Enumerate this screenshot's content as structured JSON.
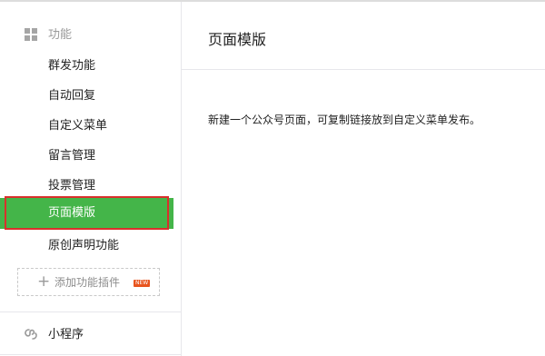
{
  "sidebar": {
    "section_title": "功能",
    "section_icon": "grid-icon",
    "items": [
      {
        "label": "群发功能"
      },
      {
        "label": "自动回复"
      },
      {
        "label": "自定义菜单"
      },
      {
        "label": "留言管理"
      },
      {
        "label": "投票管理"
      },
      {
        "label": "页面模版",
        "active": true
      },
      {
        "label": "原创声明功能"
      }
    ],
    "add_plugin": {
      "icon": "plus-icon",
      "label": "添加功能插件",
      "badge": "NEW"
    },
    "mini_program": {
      "icon": "mini-program-icon",
      "label": "小程序"
    }
  },
  "main": {
    "title": "页面模版",
    "description": "新建一个公众号页面，可复制链接放到自定义菜单发布。"
  },
  "colors": {
    "active_bg": "#44b549",
    "highlight_outline": "#d9302c",
    "badge_bg": "#e8541e"
  }
}
